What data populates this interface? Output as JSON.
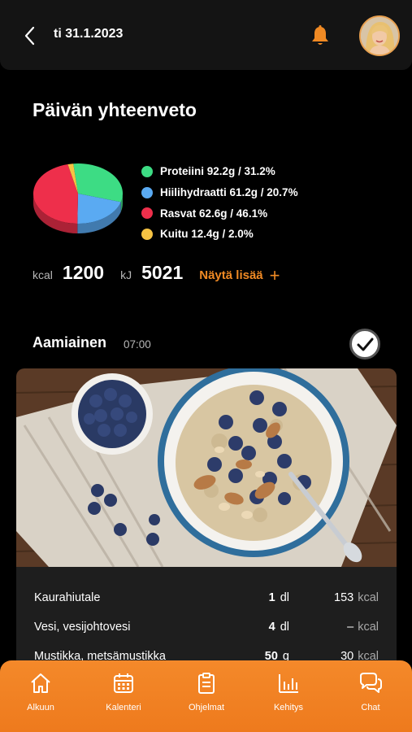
{
  "header": {
    "date": "ti 31.1.2023",
    "icons": {
      "back": "chevron-left-icon",
      "notifications": "bell-icon",
      "avatar": "user-avatar"
    },
    "accent": "#f08a24"
  },
  "summary": {
    "title": "Päivän yhteenveto",
    "legend": [
      {
        "label": "Proteiini 92.2g / 31.2%",
        "color": "#3ddc84",
        "percent": 31.2
      },
      {
        "label": "Hiilihydraatti 61.2g / 20.7%",
        "color": "#5aaaf2",
        "percent": 20.7
      },
      {
        "label": "Rasvat 62.6g / 46.1%",
        "color": "#ee2f4b",
        "percent": 46.1
      },
      {
        "label": "Kuitu 12.4g / 2.0%",
        "color": "#f6c343",
        "percent": 2.0
      }
    ],
    "kcal_unit": "kcal",
    "kcal_value": "1200",
    "kj_unit": "kJ",
    "kj_value": "5021",
    "more_label": "Näytä lisää"
  },
  "meal": {
    "name": "Aamiainen",
    "time": "07:00",
    "items": [
      {
        "name": "Kaurahiutale",
        "qty": "1",
        "unit": "dl",
        "kcal": "153",
        "kcal_unit": "kcal"
      },
      {
        "name": "Vesi, vesijohtovesi",
        "qty": "4",
        "unit": "dl",
        "kcal": "–",
        "kcal_unit": "kcal"
      },
      {
        "name": "Mustikka, metsämustikka",
        "qty": "50",
        "unit": "g",
        "kcal": "30",
        "kcal_unit": "kcal"
      }
    ]
  },
  "tabbar": {
    "color": "#f08a24",
    "tabs": [
      {
        "label": "Alkuun",
        "icon": "home-icon"
      },
      {
        "label": "Kalenteri",
        "icon": "calendar-icon"
      },
      {
        "label": "Ohjelmat",
        "icon": "clipboard-icon"
      },
      {
        "label": "Kehitys",
        "icon": "bar-chart-icon"
      },
      {
        "label": "Chat",
        "icon": "chat-icon"
      }
    ]
  }
}
